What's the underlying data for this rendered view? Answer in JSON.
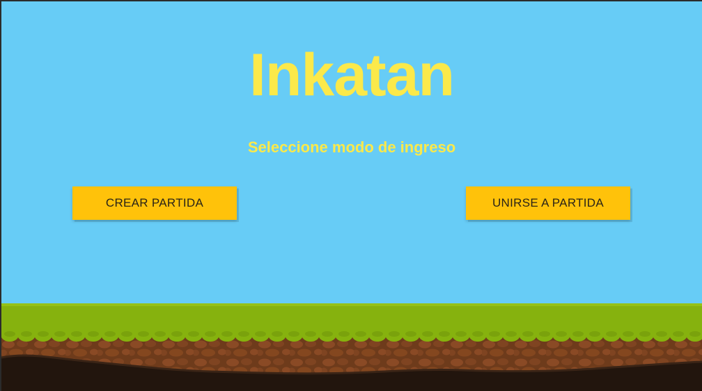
{
  "app": {
    "title": "Inkatan",
    "subtitle": "Seleccione modo de ingreso"
  },
  "buttons": {
    "create_label": "CREAR PARTIDA",
    "join_label": "UNIRSE A PARTIDA"
  },
  "colors": {
    "sky": "#67ccf6",
    "title_yellow": "#fbe94a",
    "button_yellow": "#ffc20a",
    "grass": "#86b20e",
    "soil": "#6b3a1c",
    "bedrock": "#22150d"
  }
}
